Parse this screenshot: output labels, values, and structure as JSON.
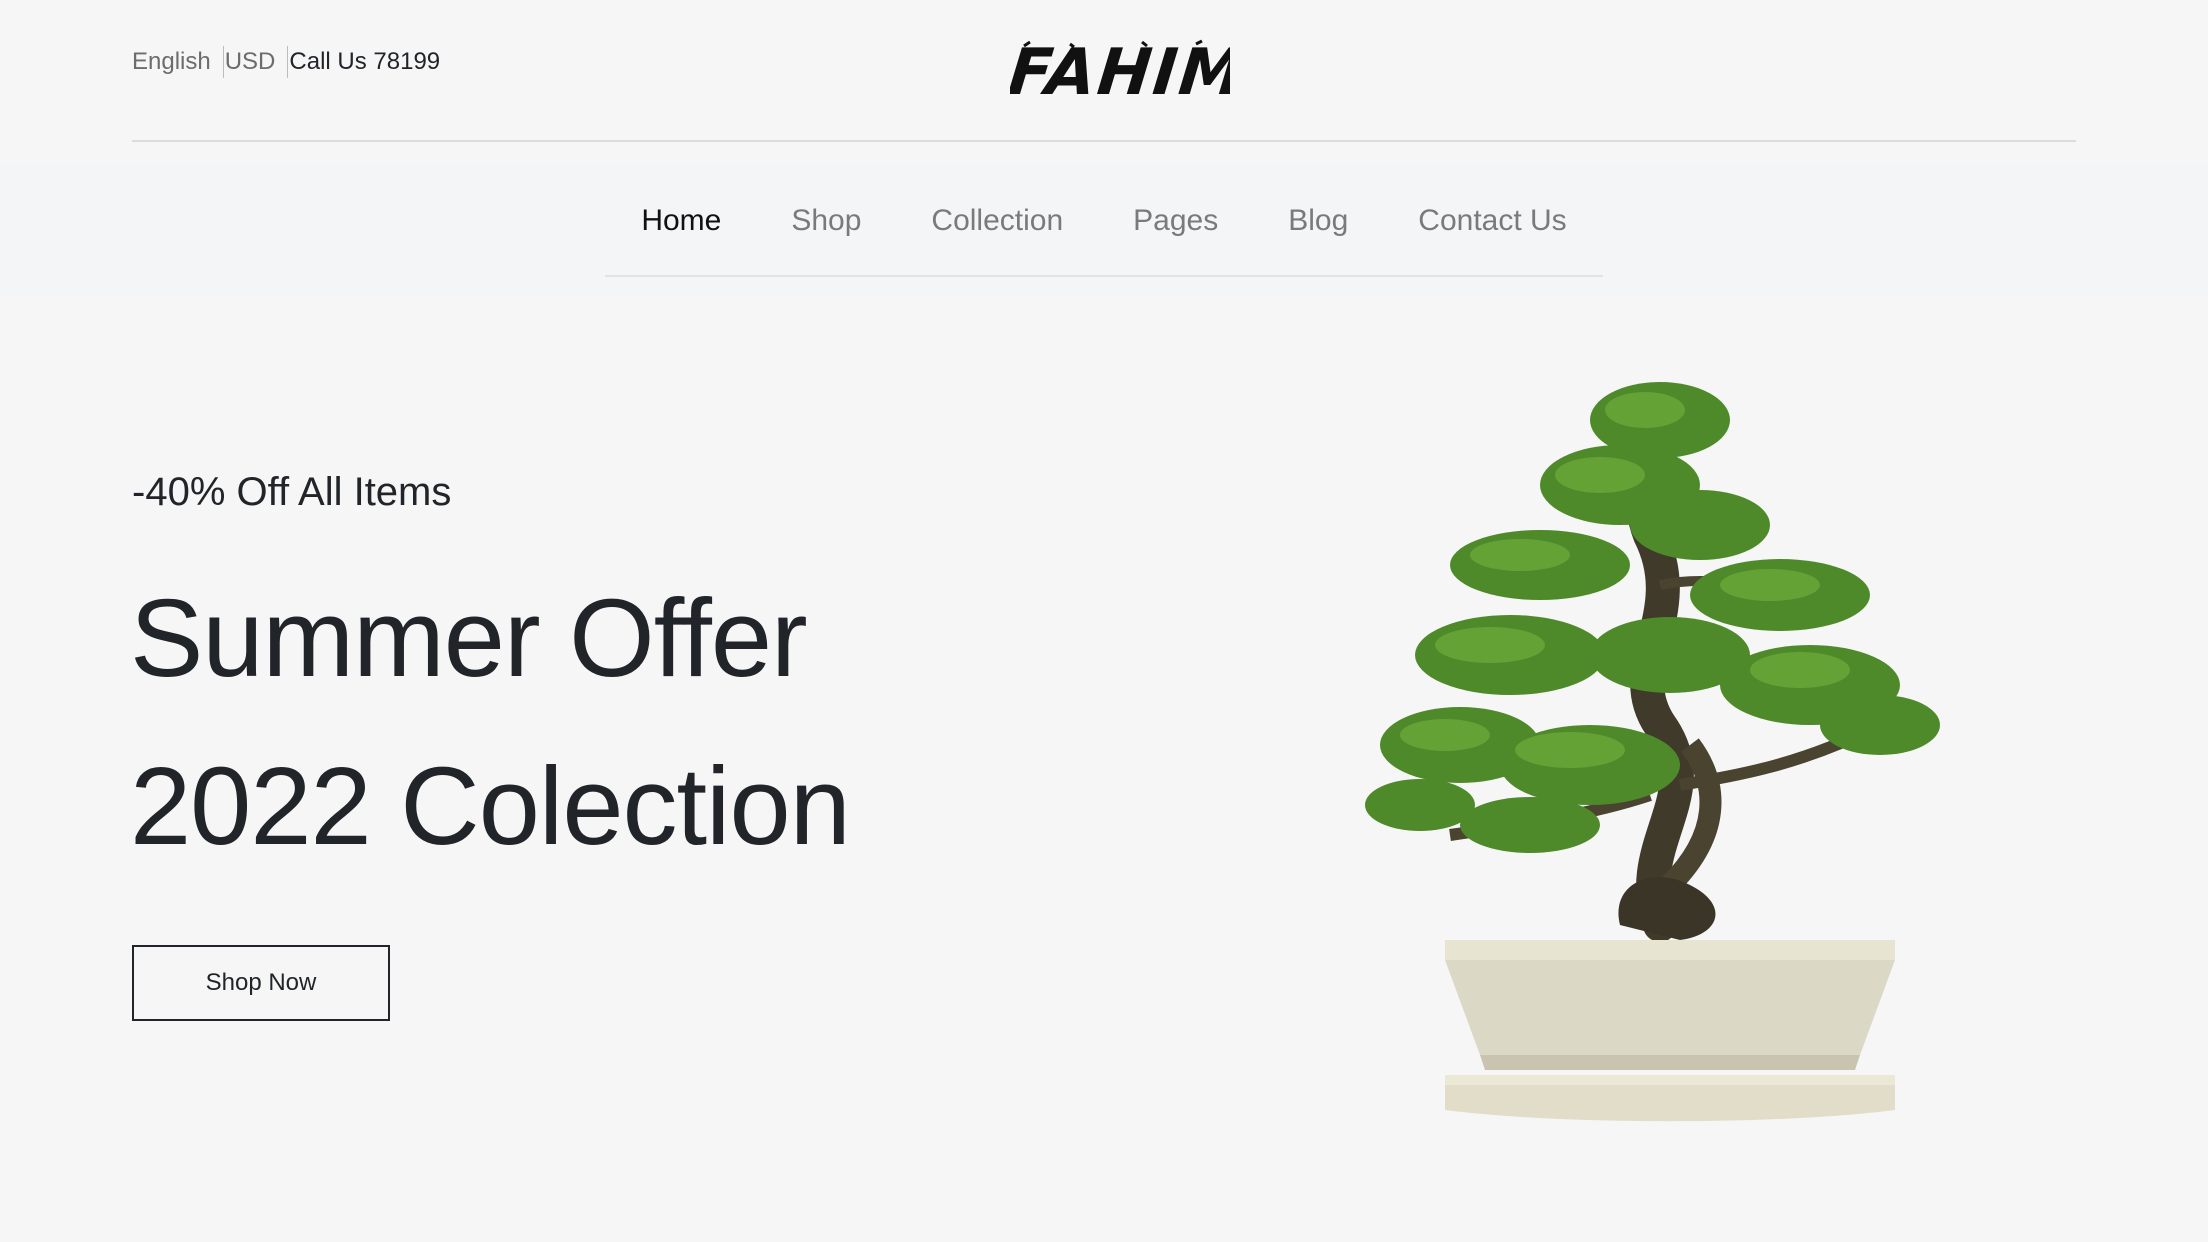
{
  "topbar": {
    "language": "English",
    "currency": "USD",
    "call": "Call Us 78199",
    "logo_text": "FAHIM"
  },
  "nav": {
    "items": [
      {
        "label": "Home",
        "active": true
      },
      {
        "label": "Shop"
      },
      {
        "label": "Collection"
      },
      {
        "label": "Pages"
      },
      {
        "label": "Blog"
      },
      {
        "label": "Contact Us"
      }
    ]
  },
  "hero": {
    "subtitle": "-40% Off All Items",
    "title_line1": "Summer Offer",
    "title_line2": "2022 Colection",
    "button": "Shop Now",
    "image": "bonsai-tree-in-pot"
  },
  "colors": {
    "background": "#f6f6f7",
    "text": "#212529",
    "muted": "#7a7a7a",
    "leaf": "#4e8a2a"
  }
}
